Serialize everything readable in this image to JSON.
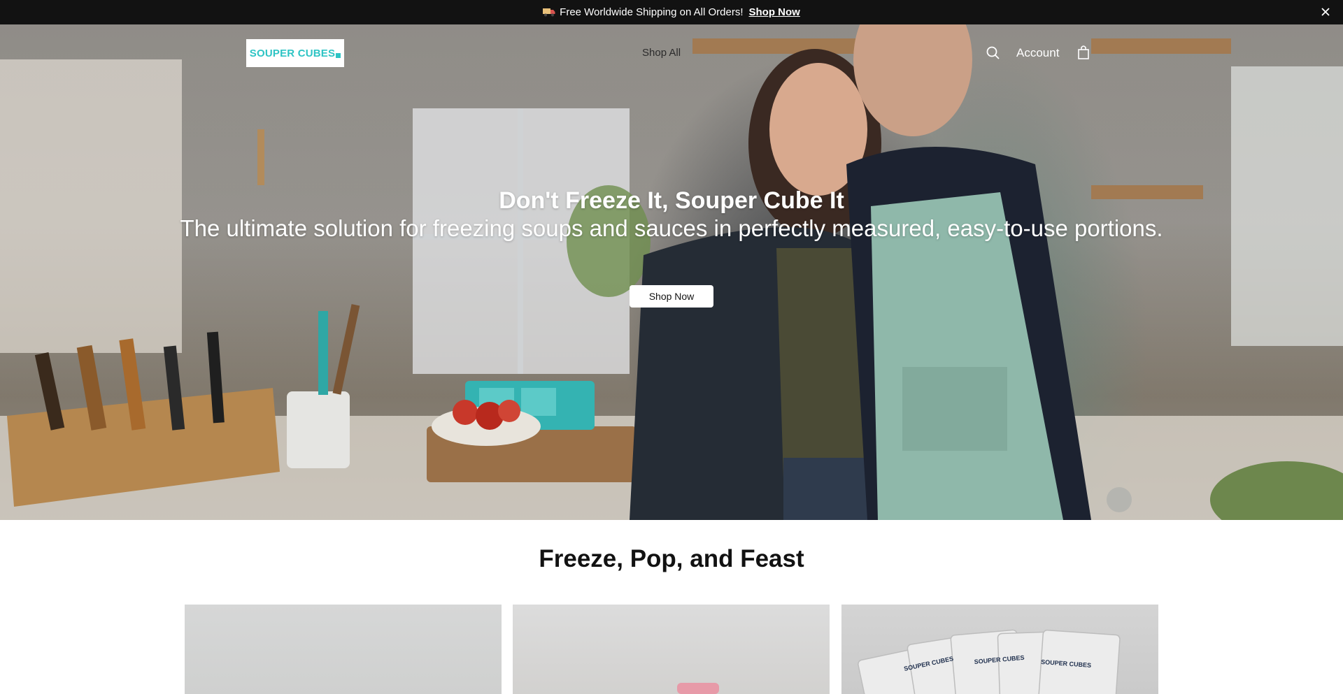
{
  "announcement": {
    "text": "Free Worldwide Shipping on All Orders!",
    "link_label": "Shop Now",
    "icon": "truck-icon",
    "close_icon": "close-icon"
  },
  "header": {
    "logo_text": "SOUPER CUBES",
    "nav": {
      "shop_all": "Shop All"
    },
    "account_label": "Account",
    "icons": [
      "search-icon",
      "shopping-bag-icon"
    ]
  },
  "hero": {
    "title": "Don't Freeze It, Souper Cube It",
    "subtitle": "The ultimate solution for freezing soups and sauces in perfectly measured, easy-to-use portions.",
    "cta_label": "Shop Now"
  },
  "section": {
    "title": "Freeze, Pop, and Feast",
    "cards": [
      {
        "id": "card-1"
      },
      {
        "id": "card-2"
      },
      {
        "id": "card-3",
        "bag_label": "SOUPER CUBES"
      }
    ]
  },
  "colors": {
    "announcement_bg": "#121212",
    "brand_teal": "#2ec4c4",
    "text_dark": "#121212",
    "apron": "#8fb8aa"
  }
}
